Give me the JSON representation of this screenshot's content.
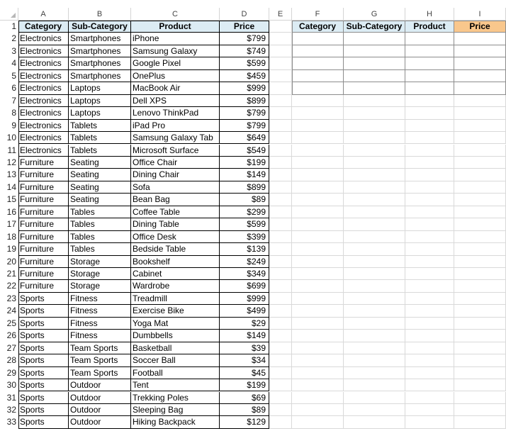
{
  "columns": [
    "A",
    "B",
    "C",
    "D",
    "E",
    "F",
    "G",
    "H",
    "I"
  ],
  "headers": [
    "Category",
    "Sub-Category",
    "Product",
    "Price"
  ],
  "rows": [
    [
      "Electronics",
      "Smartphones",
      "iPhone",
      "$799"
    ],
    [
      "Electronics",
      "Smartphones",
      "Samsung Galaxy",
      "$749"
    ],
    [
      "Electronics",
      "Smartphones",
      "Google Pixel",
      "$599"
    ],
    [
      "Electronics",
      "Smartphones",
      "OnePlus",
      "$459"
    ],
    [
      "Electronics",
      "Laptops",
      "MacBook Air",
      "$999"
    ],
    [
      "Electronics",
      "Laptops",
      "Dell XPS",
      "$899"
    ],
    [
      "Electronics",
      "Laptops",
      "Lenovo ThinkPad",
      "$799"
    ],
    [
      "Electronics",
      "Tablets",
      "iPad Pro",
      "$799"
    ],
    [
      "Electronics",
      "Tablets",
      "Samsung Galaxy Tab",
      "$649"
    ],
    [
      "Electronics",
      "Tablets",
      "Microsoft Surface",
      "$549"
    ],
    [
      "Furniture",
      "Seating",
      "Office Chair",
      "$199"
    ],
    [
      "Furniture",
      "Seating",
      "Dining Chair",
      "$149"
    ],
    [
      "Furniture",
      "Seating",
      "Sofa",
      "$899"
    ],
    [
      "Furniture",
      "Seating",
      "Bean Bag",
      "$89"
    ],
    [
      "Furniture",
      "Tables",
      "Coffee Table",
      "$299"
    ],
    [
      "Furniture",
      "Tables",
      "Dining Table",
      "$599"
    ],
    [
      "Furniture",
      "Tables",
      "Office Desk",
      "$399"
    ],
    [
      "Furniture",
      "Tables",
      "Bedside Table",
      "$139"
    ],
    [
      "Furniture",
      "Storage",
      "Bookshelf",
      "$249"
    ],
    [
      "Furniture",
      "Storage",
      "Cabinet",
      "$349"
    ],
    [
      "Furniture",
      "Storage",
      "Wardrobe",
      "$699"
    ],
    [
      "Sports",
      "Fitness",
      "Treadmill",
      "$999"
    ],
    [
      "Sports",
      "Fitness",
      "Exercise Bike",
      "$499"
    ],
    [
      "Sports",
      "Fitness",
      "Yoga Mat",
      "$29"
    ],
    [
      "Sports",
      "Fitness",
      "Dumbbells",
      "$149"
    ],
    [
      "Sports",
      "Team Sports",
      "Basketball",
      "$39"
    ],
    [
      "Sports",
      "Team Sports",
      "Soccer Ball",
      "$34"
    ],
    [
      "Sports",
      "Team Sports",
      "Football",
      "$45"
    ],
    [
      "Sports",
      "Outdoor",
      "Tent",
      "$199"
    ],
    [
      "Sports",
      "Outdoor",
      "Trekking Poles",
      "$69"
    ],
    [
      "Sports",
      "Outdoor",
      "Sleeping Bag",
      "$89"
    ],
    [
      "Sports",
      "Outdoor",
      "Hiking Backpack",
      "$129"
    ]
  ],
  "output_headers": [
    "Category",
    "Sub-Category",
    "Product",
    "Price"
  ],
  "output_rows": [
    [
      "",
      "",
      "",
      ""
    ],
    [
      "",
      "",
      "",
      ""
    ],
    [
      "",
      "",
      "",
      ""
    ],
    [
      "",
      "",
      "",
      ""
    ],
    [
      "",
      "",
      "",
      ""
    ]
  ],
  "colors": {
    "header_fill": "#dcecf4",
    "price_header_fill": "#f9c78c",
    "gridline": "#d9d9d9"
  }
}
